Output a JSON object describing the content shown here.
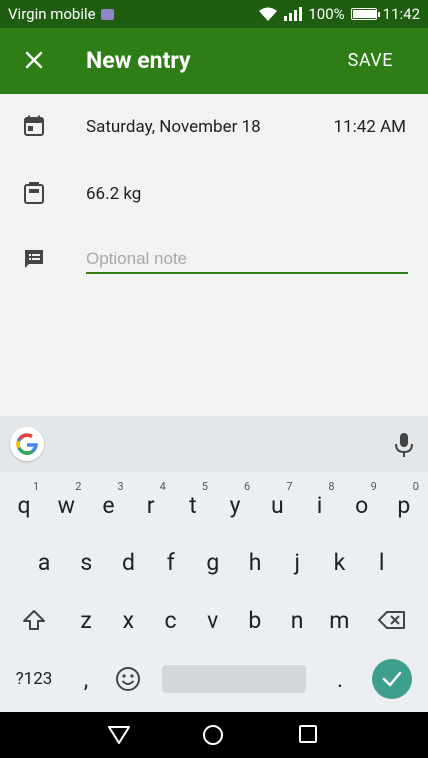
{
  "status_bar": {
    "carrier": "Virgin mobile",
    "battery": "100%",
    "time": "11:42"
  },
  "appbar": {
    "title": "New entry",
    "save_label": "SAVE"
  },
  "entry": {
    "date": "Saturday, November 18",
    "time": "11:42 AM",
    "weight": "66.2 kg",
    "note_placeholder": "Optional note"
  },
  "keyboard": {
    "row1": [
      "q",
      "w",
      "e",
      "r",
      "t",
      "y",
      "u",
      "i",
      "o",
      "p"
    ],
    "row1_hints": [
      "1",
      "2",
      "3",
      "4",
      "5",
      "6",
      "7",
      "8",
      "9",
      "0"
    ],
    "row2": [
      "a",
      "s",
      "d",
      "f",
      "g",
      "h",
      "j",
      "k",
      "l"
    ],
    "row3": [
      "z",
      "x",
      "c",
      "v",
      "b",
      "n",
      "m"
    ],
    "symbols_label": "?123",
    "comma": ",",
    "period": "."
  },
  "colors": {
    "appbar": "#2e7d16",
    "statusbar": "#1f5e10",
    "accent": "#2e7d16",
    "enter": "#3f9f8d"
  }
}
